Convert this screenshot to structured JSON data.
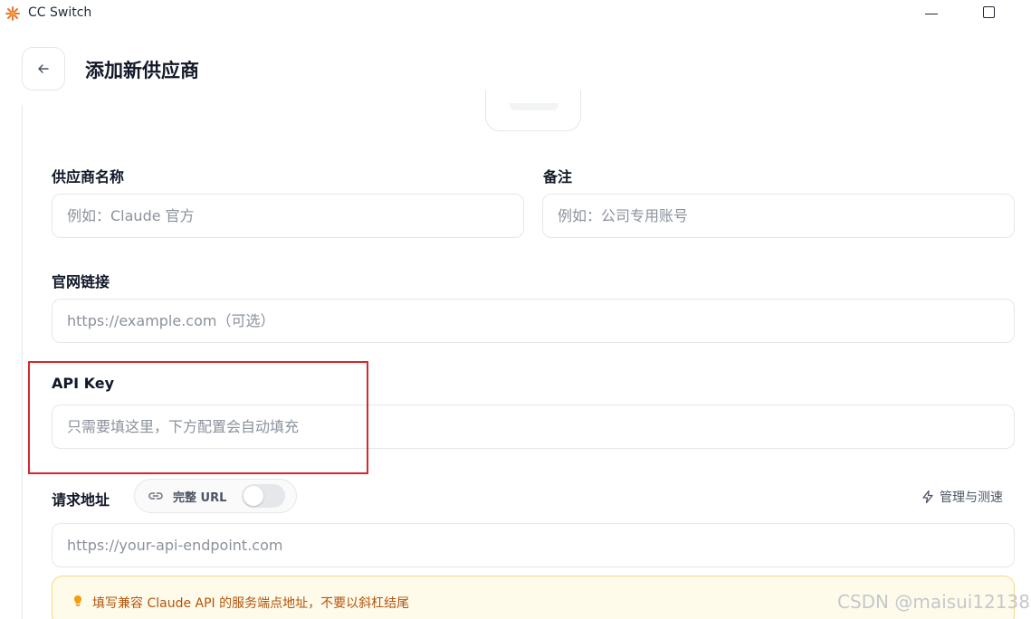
{
  "window": {
    "title": "CC Switch",
    "icon": "cc-switch-logo-icon",
    "controls": [
      "minimize-icon",
      "maximize-icon"
    ]
  },
  "header": {
    "back_icon": "arrow-left-icon",
    "title": "添加新供应商"
  },
  "form": {
    "provider_name": {
      "label": "供应商名称",
      "placeholder": "例如：Claude 官方",
      "value": ""
    },
    "notes": {
      "label": "备注",
      "placeholder": "例如：公司专用账号",
      "value": ""
    },
    "website": {
      "label": "官网链接",
      "placeholder": "https://example.com（可选）",
      "value": ""
    },
    "api_key": {
      "label": "API Key",
      "placeholder": "只需要填这里，下方配置会自动填充",
      "value": ""
    },
    "endpoint": {
      "label": "请求地址",
      "full_url_label": "完整 URL",
      "full_url_enabled": false,
      "manage_label": "管理与测速",
      "placeholder": "https://your-api-endpoint.com",
      "value": "",
      "hint": "填写兼容 Claude API 的服务端点地址，不要以斜杠结尾"
    }
  },
  "watermark": "CSDN @maisui12138",
  "colors": {
    "highlight_border": "#d7262c",
    "hint_background": "#fffbeb",
    "hint_text": "#b45309",
    "hint_icon": "#f59e0b"
  }
}
